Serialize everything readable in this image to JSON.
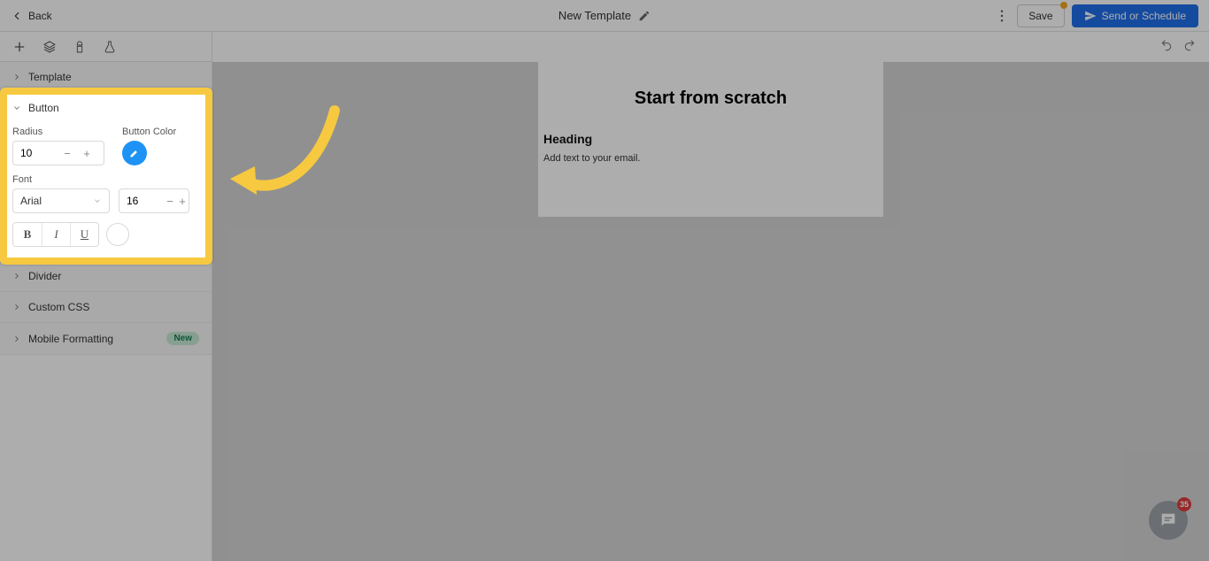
{
  "header": {
    "back_label": "Back",
    "title": "New Template",
    "save_label": "Save",
    "send_label": "Send or Schedule"
  },
  "sidebar": {
    "template_label": "Template",
    "button_label": "Button",
    "divider_label": "Divider",
    "custom_css_label": "Custom CSS",
    "mobile_formatting_label": "Mobile Formatting",
    "new_badge": "New"
  },
  "button_panel": {
    "radius_label": "Radius",
    "radius_value": "10",
    "button_color_label": "Button Color",
    "font_label": "Font",
    "font_family": "Arial",
    "font_size": "16",
    "bold": "B",
    "italic": "I",
    "underline": "U"
  },
  "canvas": {
    "title": "Start from scratch",
    "heading": "Heading",
    "body": "Add text to your email."
  },
  "chat": {
    "badge": "35"
  }
}
